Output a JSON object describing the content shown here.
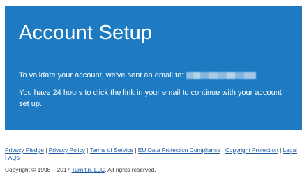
{
  "panel": {
    "title": "Account Setup",
    "message_prefix": "To validate your account, we've sent an email to:",
    "message_expiry": "You have 24 hours to click the link in your email to continue with your account set up.",
    "accent_color": "#1e7bc2"
  },
  "footer": {
    "links": [
      {
        "label": "Privacy Pledge"
      },
      {
        "label": "Privacy Policy"
      },
      {
        "label": "Terms of Service"
      },
      {
        "label": "EU Data Protection Compliance"
      },
      {
        "label": "Copyright Protection"
      },
      {
        "label": "Legal FAQs"
      }
    ],
    "separator": "|",
    "copyright_prefix": "Copyright © 1998 – 2017",
    "copyright_link": "Turnitin, LLC",
    "copyright_suffix": ". All rights reserved."
  }
}
